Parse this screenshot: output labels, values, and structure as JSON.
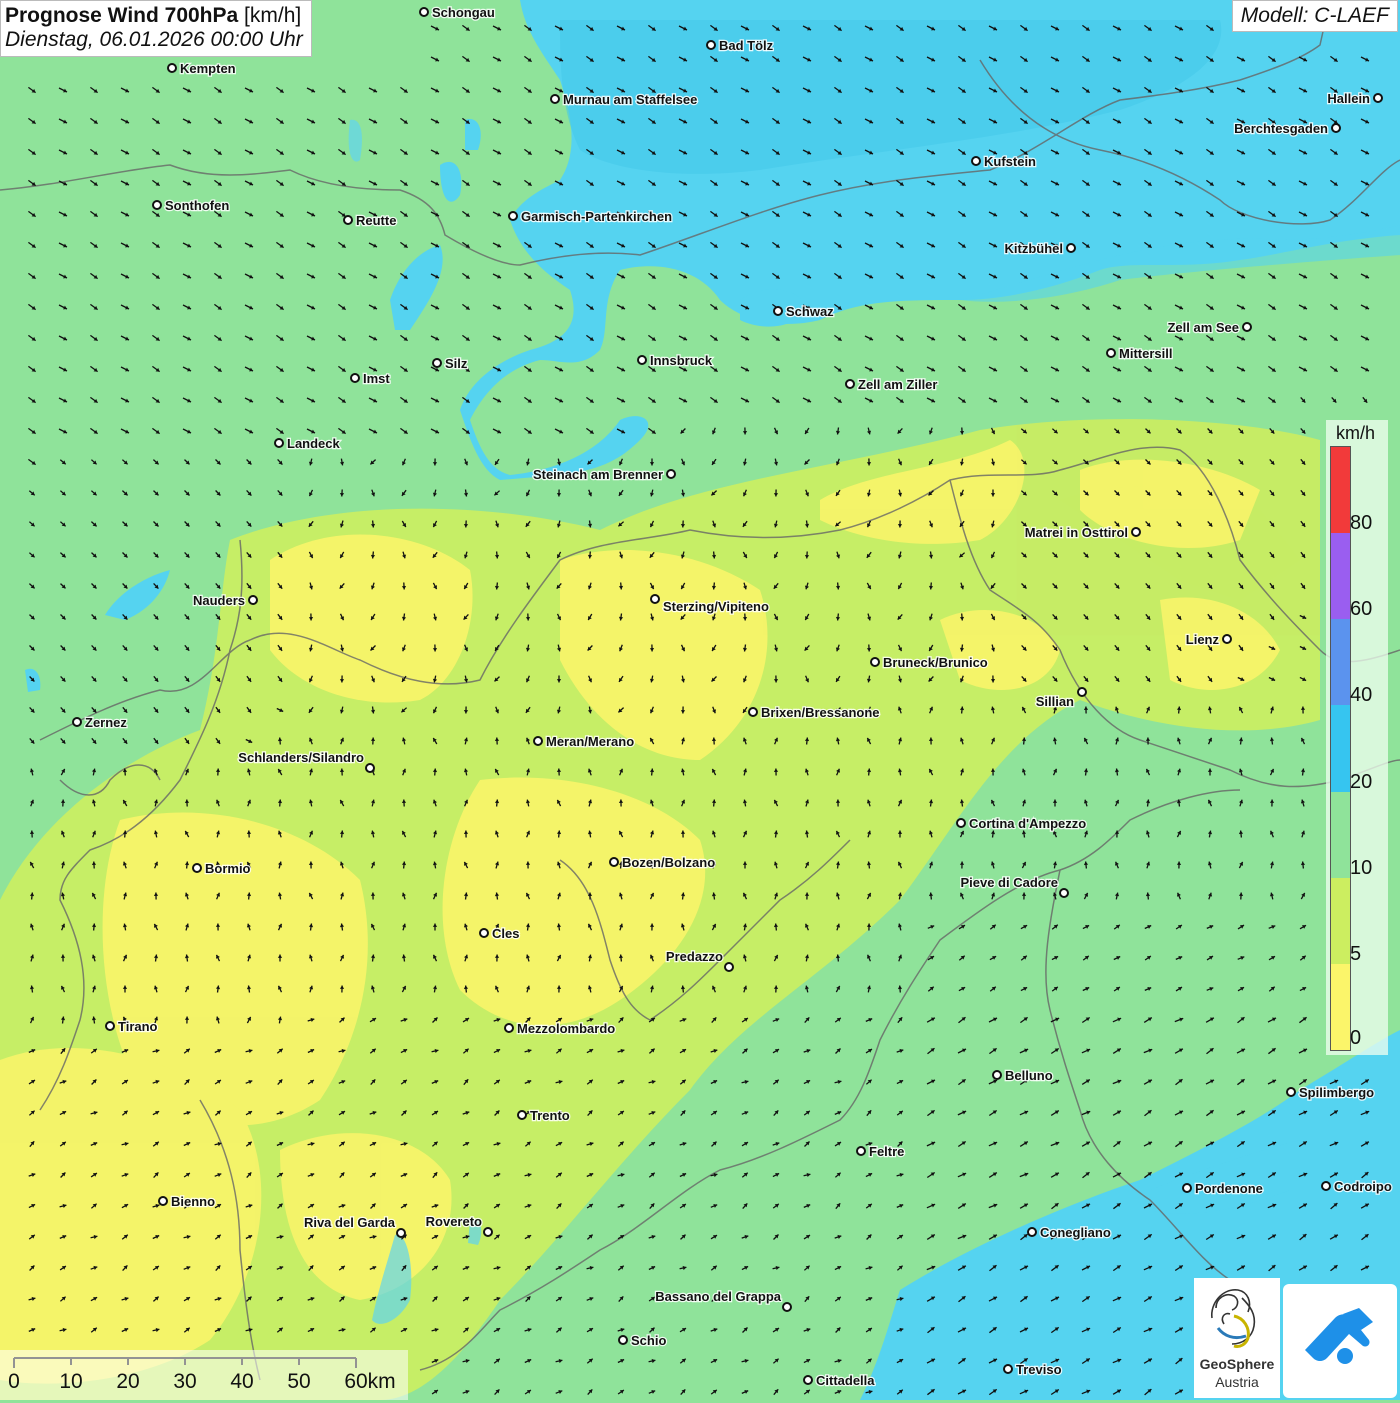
{
  "header": {
    "title_bold": "Prognose Wind 700hPa",
    "title_unit": "[km/h]",
    "datetime": "Dienstag, 06.01.2026 00:00 Uhr",
    "model": "Modell: C-LAEF"
  },
  "legend": {
    "unit": "km/h",
    "ticks": [
      "0",
      "5",
      "10",
      "20",
      "40",
      "60",
      "80"
    ],
    "colors": [
      "#fbf56a",
      "#ccee60",
      "#8fe39a",
      "#36c5f0",
      "#5b93ee",
      "#9a5ef0",
      "#f23a3a"
    ]
  },
  "scalebar": {
    "labels": [
      "0",
      "10",
      "20",
      "30",
      "40",
      "50",
      "60km"
    ]
  },
  "logos": {
    "geosphere_line1": "GeoSphere",
    "geosphere_line2": "Austria",
    "geosphere_icon": "geosphere-logo",
    "app_icon": "wind-app-logo"
  },
  "cities": [
    {
      "name": "Schongau"
    },
    {
      "name": "Kempten"
    },
    {
      "name": "Bad Tölz"
    },
    {
      "name": "Murnau am Staffelsee"
    },
    {
      "name": "Hallein"
    },
    {
      "name": "Berchtesgaden"
    },
    {
      "name": "Kufstein"
    },
    {
      "name": "Sonthofen"
    },
    {
      "name": "Reutte"
    },
    {
      "name": "Garmisch-Partenkirchen"
    },
    {
      "name": "Kitzbühel"
    },
    {
      "name": "Schwaz"
    },
    {
      "name": "Zell am See"
    },
    {
      "name": "Mittersill"
    },
    {
      "name": "Innsbruck"
    },
    {
      "name": "Silz"
    },
    {
      "name": "Imst"
    },
    {
      "name": "Zell am Ziller"
    },
    {
      "name": "Landeck"
    },
    {
      "name": "Steinach am Brenner"
    },
    {
      "name": "Matrei in Osttirol"
    },
    {
      "name": "Nauders"
    },
    {
      "name": "Sterzing/Vipiteno"
    },
    {
      "name": "Lienz"
    },
    {
      "name": "Bruneck/Brunico"
    },
    {
      "name": "Sillian"
    },
    {
      "name": "Brixen/Bressanone"
    },
    {
      "name": "Zernez"
    },
    {
      "name": "Meran/Merano"
    },
    {
      "name": "Schlanders/Silandro"
    },
    {
      "name": "Cortina d'Ampezzo"
    },
    {
      "name": "Bozen/Bolzano"
    },
    {
      "name": "Bormio"
    },
    {
      "name": "Pieve di Cadore"
    },
    {
      "name": "Cles"
    },
    {
      "name": "Predazzo"
    },
    {
      "name": "Tirano"
    },
    {
      "name": "Mezzolombardo"
    },
    {
      "name": "Belluno"
    },
    {
      "name": "Spilimbergo"
    },
    {
      "name": "Trento"
    },
    {
      "name": "Feltre"
    },
    {
      "name": "Bienno"
    },
    {
      "name": "Pordenone"
    },
    {
      "name": "Codroipo"
    },
    {
      "name": "Riva del Garda"
    },
    {
      "name": "Rovereto"
    },
    {
      "name": "Conegliano"
    },
    {
      "name": "Bassano del Grappa"
    },
    {
      "name": "Schio"
    },
    {
      "name": "Treviso"
    },
    {
      "name": "Cittadella"
    }
  ]
}
